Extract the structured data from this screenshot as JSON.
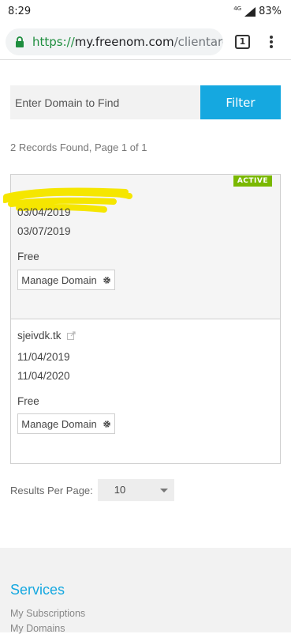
{
  "statusbar": {
    "time": "8:29",
    "network": "4G",
    "battery": "83%"
  },
  "browser": {
    "url_scheme": "https://",
    "url_host": "my.freenom.com",
    "url_path": "/clientarea.p",
    "tab_count": "1"
  },
  "search": {
    "placeholder": "Enter Domain to Find",
    "filter_label": "Filter"
  },
  "records_text": "2 Records Found, Page 1 of 1",
  "domains": [
    {
      "status": "ACTIVE",
      "name": "",
      "registered": "03/04/2019",
      "expires": "03/07/2019",
      "type": "Free",
      "manage_label": "Manage Domain"
    },
    {
      "status": "",
      "name": "sjeivdk.tk",
      "registered": "11/04/2019",
      "expires": "11/04/2020",
      "type": "Free",
      "manage_label": "Manage Domain"
    }
  ],
  "results_per_page": {
    "label": "Results Per Page:",
    "value": "10"
  },
  "footer": {
    "title": "Services",
    "links": [
      "My Subscriptions",
      "My Domains"
    ]
  },
  "colors": {
    "accent": "#15a8e0",
    "active_badge": "#7ab800",
    "url_secure": "#1e8e3e",
    "redaction": "#f5e600"
  }
}
